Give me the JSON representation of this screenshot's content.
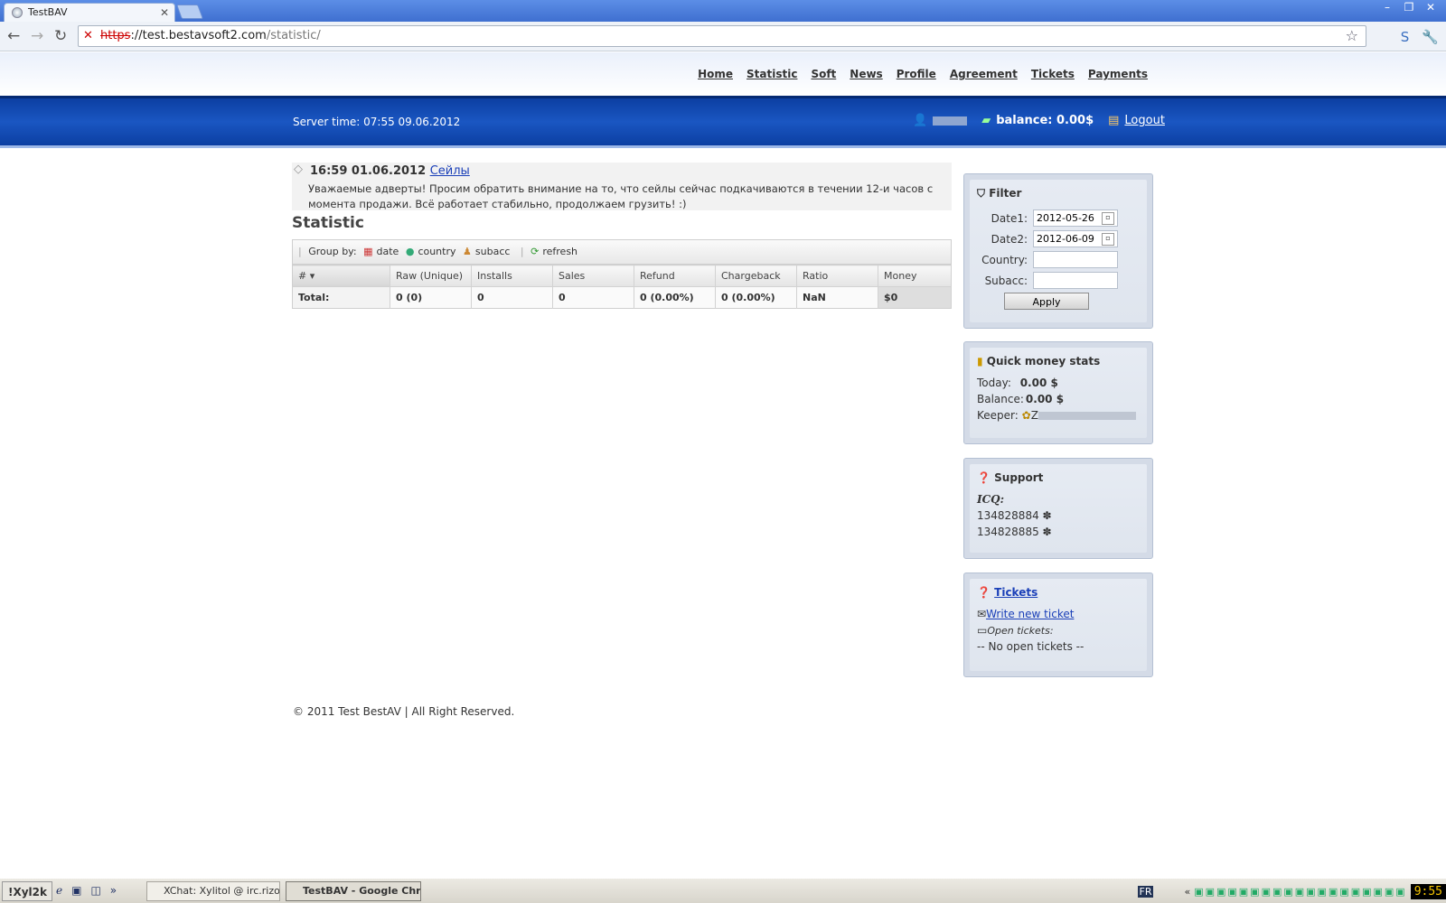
{
  "browser": {
    "tab_title": "TestBAV",
    "url_proto": "https",
    "url_host": "://test.bestavsoft2.com",
    "url_path": "/statistic/"
  },
  "nav": {
    "items": [
      "Home",
      "Statistic",
      "Soft",
      "News",
      "Profile",
      "Agreement",
      "Tickets",
      "Payments"
    ]
  },
  "header": {
    "server_time": "Server time: 07:55 09.06.2012",
    "balance": "balance: 0.00$",
    "logout": "Logout"
  },
  "news": {
    "datetime": "16:59 01.06.2012",
    "link": "Сейлы",
    "text": "Уважаемые адверты! Просим обратить внимание на то, что сейлы сейчас подкачиваются в течении 12-и часов с момента продажи. Всё работает стабильно, продолжаем грузить! :)"
  },
  "statistic": {
    "title": "Statistic",
    "group_by_label": "Group by:",
    "group_options": [
      "date",
      "country",
      "subacc"
    ],
    "refresh": "refresh",
    "columns": [
      "#",
      "Raw (Unique)",
      "Installs",
      "Sales",
      "Refund",
      "Chargeback",
      "Ratio",
      "Money"
    ],
    "total_row": [
      "Total:",
      "0 (0)",
      "0",
      "0",
      "0 (0.00%)",
      "0 (0.00%)",
      "NaN",
      "$0"
    ]
  },
  "filter": {
    "title": "Filter",
    "date1_label": "Date1:",
    "date1_value": "2012-05-26",
    "date2_label": "Date2:",
    "date2_value": "2012-06-09",
    "country_label": "Country:",
    "subacc_label": "Subacc:",
    "apply": "Apply"
  },
  "money": {
    "title": "Quick money stats",
    "today_label": "Today:",
    "today_value": "0.00 $",
    "balance_label": "Balance:",
    "balance_value": "0.00 $",
    "keeper_label": "Keeper:",
    "keeper_value": "Z"
  },
  "support": {
    "title": "Support",
    "icq_label": "ICQ:",
    "icq1": "134828884",
    "icq2": "134828885"
  },
  "tickets": {
    "title": "Tickets",
    "write_new": "Write new ticket",
    "open_label": "Open tickets:",
    "none": "-- No open tickets --"
  },
  "footer": {
    "text": "© 2011 Test BestAV | All Right Reserved."
  },
  "taskbar": {
    "start": "!Xyl2k",
    "xchat": "XChat: Xylitol @ irc.rizon....",
    "chrome": "TestBAV - Google Chr...",
    "lang": "FR",
    "clock": "9:55"
  }
}
